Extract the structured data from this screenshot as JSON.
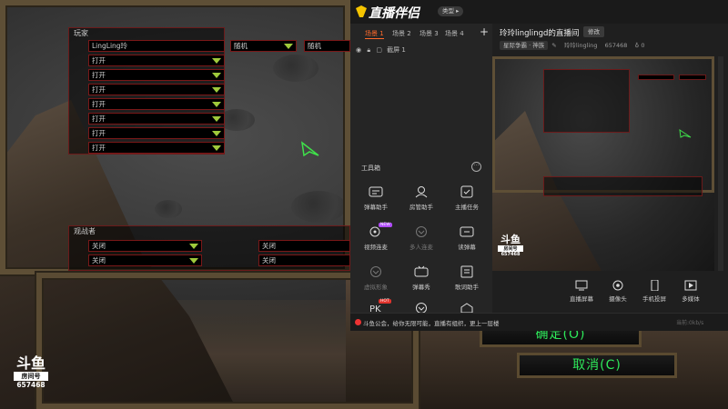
{
  "game": {
    "players_title": "玩家",
    "player1_name": "LingLing玲",
    "player1_race": "随机",
    "player1_team": "随机",
    "open_slots": [
      "打开",
      "打开",
      "打开",
      "打开",
      "打开",
      "打开",
      "打开"
    ],
    "observers_title": "观战者",
    "observer_slots_left": [
      "关闭",
      "关闭"
    ],
    "observer_slots_right": [
      "关闭",
      "关闭"
    ],
    "confirm_label": "确定(O)",
    "cancel_label": "取消(C)"
  },
  "douyu": {
    "logo_mark": "斗鱼",
    "room_label": "房间号",
    "room_number": "657468"
  },
  "app": {
    "title": "直播伴侣",
    "version_label": "类型 ▸",
    "scene_tabs": [
      "场景 1",
      "场景 2",
      "场景 3",
      "场景 4"
    ],
    "active_scene": 0,
    "source_name": "截屏 1",
    "toolbox_title": "工具箱",
    "tools": [
      {
        "label": "弹幕助手",
        "icon": "danmu-icon"
      },
      {
        "label": "房管助手",
        "icon": "room-manager-icon"
      },
      {
        "label": "主播任务",
        "icon": "task-icon"
      },
      {
        "label": "视频连麦",
        "icon": "video-link-icon",
        "badge": "NEW"
      },
      {
        "label": "多人连麦",
        "icon": "multi-link-icon"
      },
      {
        "label": "读弹幕",
        "icon": "read-danmu-icon"
      },
      {
        "label": "虚拟形象",
        "icon": "avatar-icon"
      },
      {
        "label": "弹幕秀",
        "icon": "danmu-show-icon"
      },
      {
        "label": "歌词助手",
        "icon": "lyrics-icon"
      },
      {
        "label": "",
        "icon": "pk-icon",
        "badge": "HOT"
      },
      {
        "label": "",
        "icon": "download-icon"
      },
      {
        "label": "",
        "icon": "puzzle-icon"
      }
    ],
    "room_title": "玲玲linglingd的直播间",
    "edit_label": "修改",
    "category": "星际争霸 · 神族",
    "streamer": "玲玲lingling",
    "room_id": "657468",
    "fans": "0",
    "notice": "斗鱼公会，给你无限可能，直播有组织，更上一层楼",
    "notice_right": "当前:0kb/s",
    "bottom_tools": [
      {
        "label": "直播屏幕",
        "icon": "screen-icon"
      },
      {
        "label": "摄像头",
        "icon": "camera-icon"
      },
      {
        "label": "手机投屏",
        "icon": "phone-cast-icon"
      },
      {
        "label": "多媒体",
        "icon": "media-icon"
      }
    ]
  }
}
